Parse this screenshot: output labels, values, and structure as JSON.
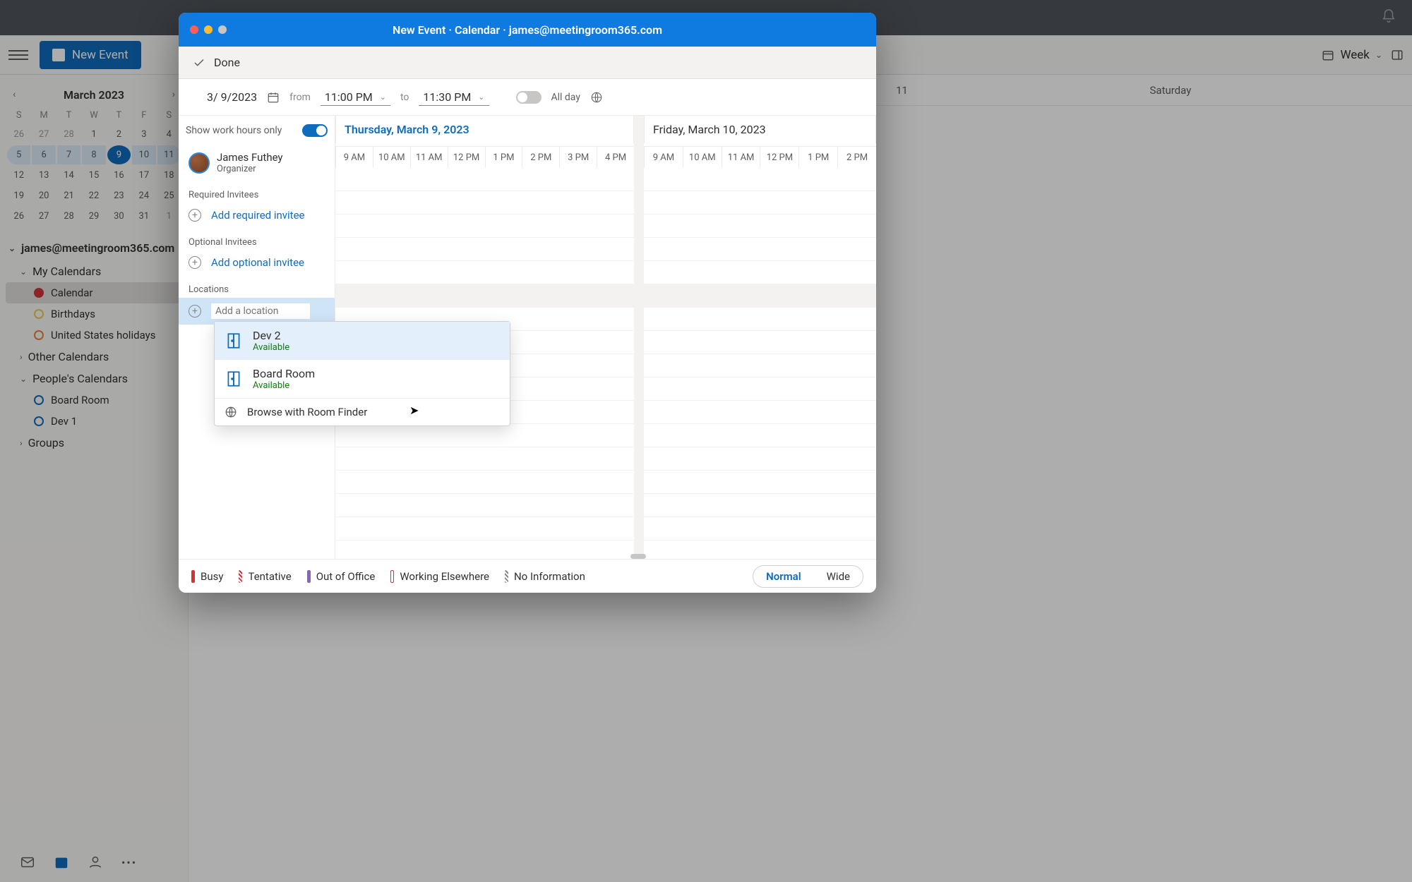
{
  "bg": {
    "new_event_btn": "New Event",
    "view": "Week",
    "month_title": "March 2023",
    "dow": [
      "S",
      "M",
      "T",
      "W",
      "T",
      "F",
      "S"
    ],
    "days": [
      {
        "n": "26",
        "other": true
      },
      {
        "n": "27",
        "other": true
      },
      {
        "n": "28",
        "other": true
      },
      {
        "n": "1"
      },
      {
        "n": "2"
      },
      {
        "n": "3"
      },
      {
        "n": "4"
      },
      {
        "n": "5",
        "selweek": true,
        "first": true
      },
      {
        "n": "6",
        "selweek": true
      },
      {
        "n": "7",
        "selweek": true
      },
      {
        "n": "8",
        "selweek": true
      },
      {
        "n": "9",
        "selweek": true,
        "today": true
      },
      {
        "n": "10",
        "selweek": true
      },
      {
        "n": "11",
        "selweek": true,
        "last": true
      },
      {
        "n": "12"
      },
      {
        "n": "13"
      },
      {
        "n": "14"
      },
      {
        "n": "15"
      },
      {
        "n": "16"
      },
      {
        "n": "17"
      },
      {
        "n": "18"
      },
      {
        "n": "19"
      },
      {
        "n": "20"
      },
      {
        "n": "21"
      },
      {
        "n": "22"
      },
      {
        "n": "23"
      },
      {
        "n": "24"
      },
      {
        "n": "25"
      },
      {
        "n": "26"
      },
      {
        "n": "27"
      },
      {
        "n": "28"
      },
      {
        "n": "29"
      },
      {
        "n": "30"
      },
      {
        "n": "31"
      },
      {
        "n": "1",
        "other": true
      }
    ],
    "account": "james@meetingroom365.com",
    "groups": [
      {
        "label": "My Calendars",
        "expanded": true,
        "items": [
          {
            "label": "Calendar",
            "color": "red",
            "active": true,
            "filled": true
          },
          {
            "label": "Birthdays",
            "color": "yellow"
          },
          {
            "label": "United States holidays",
            "color": "orange"
          }
        ]
      },
      {
        "label": "Other Calendars",
        "expanded": false
      },
      {
        "label": "People's Calendars",
        "expanded": true,
        "items": [
          {
            "label": "Board Room",
            "color": "blue"
          },
          {
            "label": "Dev 1",
            "color": "blue"
          }
        ]
      },
      {
        "label": "Groups",
        "expanded": false
      }
    ],
    "grid_headers": [
      "11",
      "Saturday"
    ]
  },
  "modal": {
    "title": "New Event · Calendar · james@meetingroom365.com",
    "done": "Done",
    "date": "3/ 9/2023",
    "from_lbl": "from",
    "from_time": "11:00 PM",
    "to_lbl": "to",
    "to_time": "11:30 PM",
    "allday": "All day",
    "work_hours": "Show work hours only",
    "organizer": {
      "name": "James Futhey",
      "role": "Organizer"
    },
    "required_lbl": "Required Invitees",
    "add_required": "Add required invitee",
    "optional_lbl": "Optional Invitees",
    "add_optional": "Add optional invitee",
    "locations_lbl": "Locations",
    "add_location_placeholder": "Add a location",
    "days": [
      {
        "title": "Thursday, March 9, 2023",
        "selected": true,
        "hours": [
          "9 AM",
          "10 AM",
          "11 AM",
          "12 PM",
          "1 PM",
          "2 PM",
          "3 PM",
          "4 PM"
        ]
      },
      {
        "title": "Friday, March 10, 2023",
        "selected": false,
        "hours": [
          "9 AM",
          "10 AM",
          "11 AM",
          "12 PM",
          "1 PM",
          "2 PM"
        ]
      }
    ],
    "loc_dropdown": [
      {
        "name": "Dev 2",
        "status": "Available",
        "hover": true
      },
      {
        "name": "Board Room",
        "status": "Available"
      }
    ],
    "browse_label": "Browse with Room Finder",
    "legend": [
      {
        "label": "Busy",
        "cls": "busy"
      },
      {
        "label": "Tentative",
        "cls": "tent"
      },
      {
        "label": "Out of Office",
        "cls": "ooo"
      },
      {
        "label": "Working Elsewhere",
        "cls": "we"
      },
      {
        "label": "No Information",
        "cls": "noinfo"
      }
    ],
    "view_toggle": {
      "normal": "Normal",
      "wide": "Wide"
    }
  }
}
